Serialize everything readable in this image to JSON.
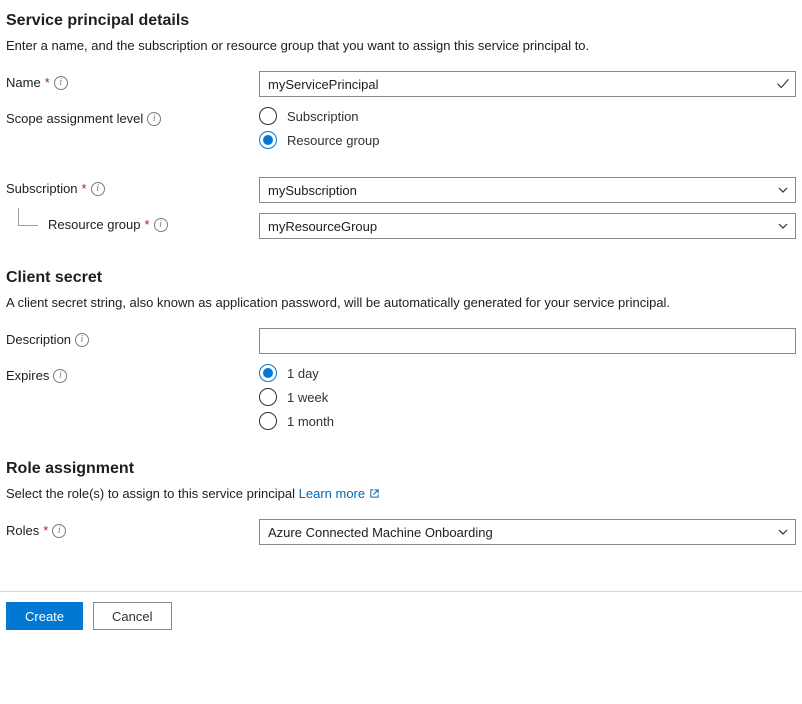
{
  "spd": {
    "heading": "Service principal details",
    "desc": "Enter a name, and the subscription or resource group that you want to assign this service principal to.",
    "name_label": "Name",
    "name_value": "myServicePrincipal",
    "scope_label": "Scope assignment level",
    "scope_options": {
      "subscription": "Subscription",
      "resource_group": "Resource group"
    },
    "scope_selected": "resource_group",
    "subscription_label": "Subscription",
    "subscription_value": "mySubscription",
    "resource_group_label": "Resource group",
    "resource_group_value": "myResourceGroup"
  },
  "secret": {
    "heading": "Client secret",
    "desc": "A client secret string, also known as application password, will be automatically generated for your service principal.",
    "description_label": "Description",
    "description_value": "",
    "expires_label": "Expires",
    "expires_options": {
      "d1": "1 day",
      "w1": "1 week",
      "m1": "1 month"
    },
    "expires_selected": "d1"
  },
  "role": {
    "heading": "Role assignment",
    "desc_prefix": "Select the role(s) to assign to this service principal",
    "learn_more": "Learn more",
    "roles_label": "Roles",
    "roles_value": "Azure Connected Machine Onboarding"
  },
  "footer": {
    "create": "Create",
    "cancel": "Cancel"
  }
}
